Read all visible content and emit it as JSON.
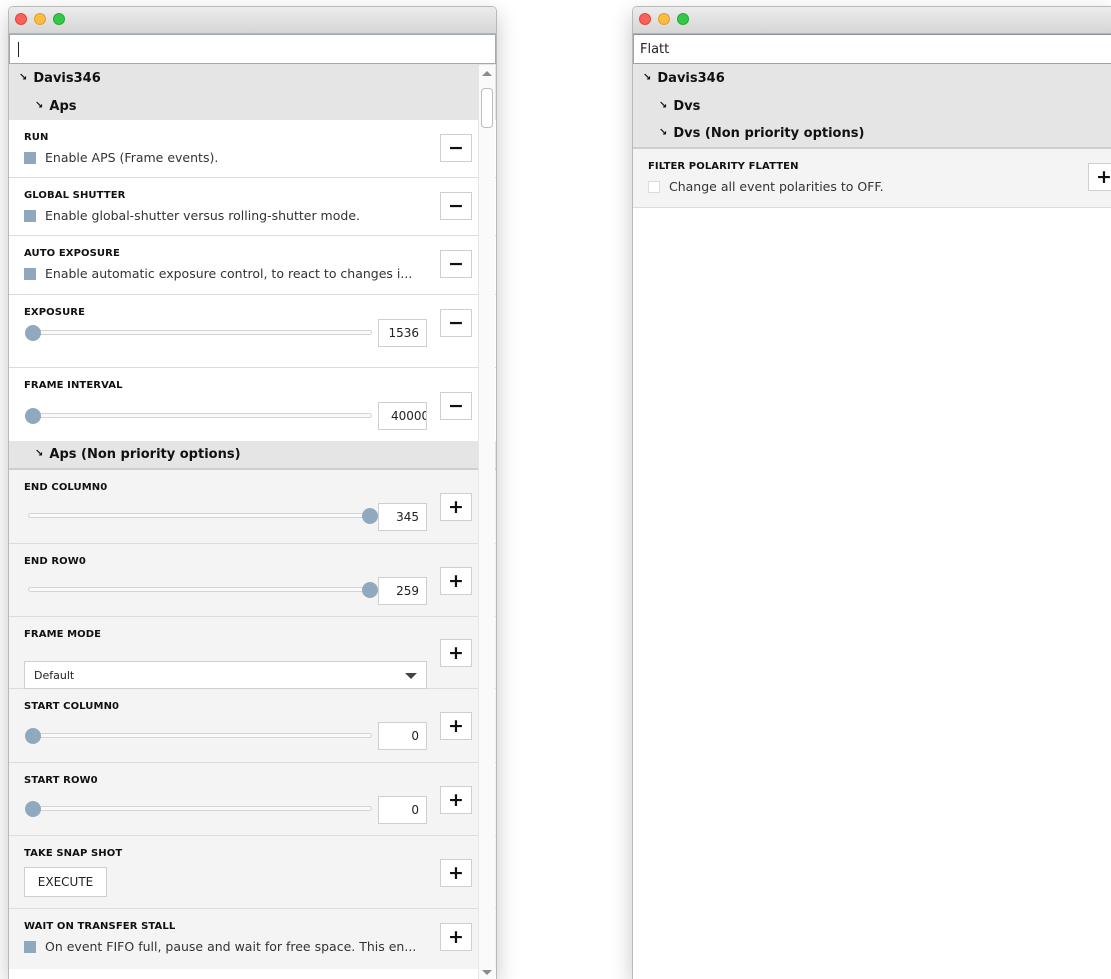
{
  "left_window": {
    "search": {
      "value": ""
    },
    "category": "Davis346",
    "subcategory": "Aps",
    "rows": [
      {
        "label": "RUN",
        "description": "Enable APS (Frame events).",
        "toggle": "−"
      },
      {
        "label": "GLOBAL SHUTTER",
        "description": "Enable global-shutter versus rolling-shutter mode.",
        "toggle": "−"
      },
      {
        "label": "AUTO EXPOSURE",
        "description": "Enable automatic exposure control, to react to changes i...",
        "toggle": "−"
      },
      {
        "label": "EXPOSURE",
        "value": "1536",
        "slider_fraction": 0.0,
        "toggle": "−"
      },
      {
        "label": "FRAME INTERVAL",
        "value": "40000",
        "slider_fraction": 0.0,
        "toggle": "−"
      }
    ],
    "nonpriority_header": "Aps (Non priority options)",
    "np_rows": [
      {
        "label": "END COLUMN0",
        "value": "345",
        "slider_fraction": 1.0,
        "toggle": "+"
      },
      {
        "label": "END ROW0",
        "value": "259",
        "slider_fraction": 1.0,
        "toggle": "+"
      },
      {
        "label": "FRAME MODE",
        "select_value": "Default",
        "toggle": "+"
      },
      {
        "label": "START COLUMN0",
        "value": "0",
        "slider_fraction": 0.0,
        "toggle": "+"
      },
      {
        "label": "START ROW0",
        "value": "0",
        "slider_fraction": 0.0,
        "toggle": "+"
      },
      {
        "label": "TAKE SNAP SHOT",
        "button_label": "EXECUTE",
        "toggle": "+"
      },
      {
        "label": "WAIT ON TRANSFER STALL",
        "description": "On event FIFO full, pause and wait for free space. This en...",
        "toggle": "+"
      }
    ]
  },
  "right_window": {
    "search": {
      "value": "Flatt"
    },
    "category": "Davis346",
    "subcategory": "Dvs",
    "nonpriority_header": "Dvs (Non priority options)",
    "rows": [
      {
        "label": "FILTER POLARITY FLATTEN",
        "description": "Change all event polarities to OFF.",
        "toggle": "+"
      }
    ]
  },
  "colors": {
    "accent": "#90a9be",
    "header_bg": "#e5e5e5",
    "row_grey": "#f4f4f4"
  }
}
